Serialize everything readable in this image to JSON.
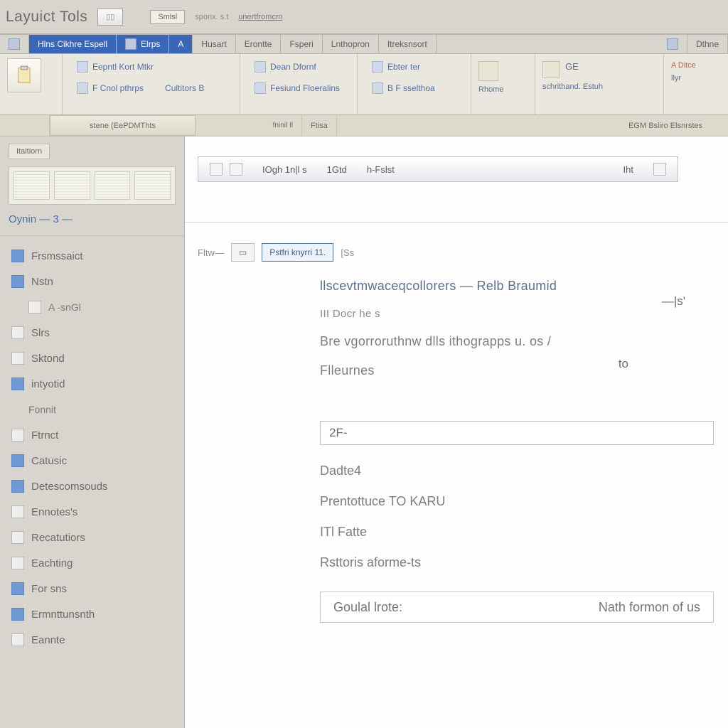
{
  "title_strip": {
    "app_title": "Layuict Tols",
    "pager_value": "▯▯",
    "little_tab": "Smlsl",
    "tiny1": "sponx. s.t",
    "tiny_link": "unertfromcrn"
  },
  "tabs": [
    {
      "label": "",
      "glyph": true
    },
    {
      "label": "Hlns  Cikhre Espell",
      "active": true
    },
    {
      "label": "Elrps",
      "glyph": true
    },
    {
      "label": "A",
      "glyph": true
    },
    {
      "label": "Husart"
    },
    {
      "label": "Erontte"
    },
    {
      "label": "Fsperi"
    },
    {
      "label": "Lnthopron"
    },
    {
      "label": "Itreksnsort"
    },
    {
      "label": "Dthne"
    }
  ],
  "ribbon": {
    "g1_top": "Eepntl Kort Mtkr",
    "g1_bot_a": "F Cnol pthrps",
    "g1_bot_b": "Cultitors B",
    "g2_top": "Dean Dfornf",
    "g2_bot": "Fesiund Floeralins",
    "g3_top": "Ebter ter",
    "g3_bot": "B F sselthoa",
    "g4": "Rhome",
    "g5_a": "GE",
    "g5_b": "schrithand. Estuh",
    "g6_a": "A Ditce",
    "g6_b": "llyr"
  },
  "subbar": {
    "left_small": "fninil Il",
    "long": "stene (EePDMThts",
    "mid": "Ftisa",
    "detail": "EGM Bsliro Elsnrstes"
  },
  "sidebar": {
    "chip": "Itaitiorn",
    "counter": "Oynin — 3 —",
    "items": [
      {
        "label": "Frsmssaict",
        "blue": true
      },
      {
        "label": "Nstn",
        "blue": true
      },
      {
        "label": "A -snGl",
        "sub": true
      },
      {
        "label": "Slrs"
      },
      {
        "label": "Sktond"
      },
      {
        "label": "intyotid",
        "blue": true
      },
      {
        "label": "Fonnit",
        "sub": true
      },
      {
        "label": "Ftrnct"
      },
      {
        "label": "Catusic",
        "blue": true
      },
      {
        "label": "Detescomsouds",
        "blue": true
      },
      {
        "label": "Ennotes's"
      },
      {
        "label": "Recatutiors"
      },
      {
        "label": "Eachting"
      },
      {
        "label": "For sns",
        "blue": true
      },
      {
        "label": "Ermnttunsnth",
        "blue": true
      },
      {
        "label": "Eannte"
      }
    ]
  },
  "canvas": {
    "floatbar": {
      "a": "IOgh 1n|l s",
      "b": "1Gtd",
      "c": "h-Fslst",
      "d": "Iht"
    },
    "midtabs": {
      "pre": "Fltw—",
      "sel": "Pstfri knyrri   11.",
      "after": "[Ss"
    },
    "lines": {
      "l1": "llscevtmwaceqcollorers — Relb Braumid",
      "l2": "III Docr he     s",
      "l3": "Bre vgorroruthnw dlls ithograpps    u. os /",
      "l4": "Flleurnes",
      "measure": "—|s'",
      "to": "to"
    },
    "input_value": "2F-",
    "blk2": {
      "a": "Dadte4",
      "b": "Prentottuce TO KARU",
      "c": "ITl Fatte",
      "d": "Rsttoris aforme-ts"
    },
    "footer": {
      "left": "Goulal lrote:",
      "right": "Nath formon of us"
    }
  }
}
